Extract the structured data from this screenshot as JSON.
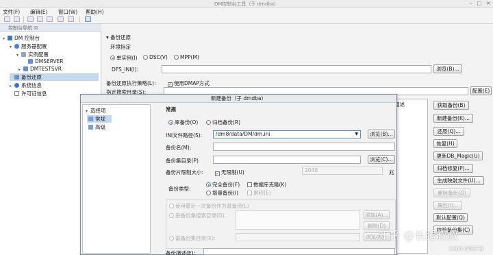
{
  "window": {
    "title": "DM控制台工具（于 dmdba）"
  },
  "menu": [
    "文件(F)",
    "编辑(E)",
    "窗口(W)",
    "帮助(H)"
  ],
  "left_panel": {
    "tab": "控制台导航 ☒",
    "tree": [
      {
        "label": "DM 控制台",
        "level": 0,
        "arrow": "▾"
      },
      {
        "label": "服务器配置",
        "level": 1,
        "arrow": "▾"
      },
      {
        "label": "实例配置",
        "level": 2,
        "arrow": "▾"
      },
      {
        "label": "DMSERVER",
        "level": 3,
        "arrow": ""
      },
      {
        "label": "DMTESTSVR",
        "level": 3,
        "arrow": "▸"
      },
      {
        "label": "备份还原",
        "level": 1,
        "arrow": "",
        "selected": true
      },
      {
        "label": "系统信息",
        "level": 1,
        "arrow": "▸"
      },
      {
        "label": "许可证信息",
        "level": 1,
        "arrow": ""
      }
    ]
  },
  "backup_restore": {
    "section_title": "▾ 备份还原",
    "env_label": "环境指定",
    "modes": [
      "单实例(I)",
      "DSC(V)",
      "MPP(M)"
    ],
    "dfs_ini_label": "DFS_INI(I):",
    "browse_label": "浏览(B)...",
    "strategy_label": "备份还原执行策略(L):",
    "use_dmap_label": "使用DMAP方式",
    "search_dir_label": "指定搜索目录(S):",
    "config_button": "配置(E)",
    "desc_header": "描述",
    "side_buttons": [
      "获取备份(B)",
      "新建备份(K)...",
      "还原(Q)...",
      "恢复(H)",
      "更新DB_Magic(U)",
      "归档修复(P)...",
      "生成映射文件(U)...",
      "删除备份(D)",
      "属性(I)...",
      "默认配置(Q)",
      "校验备份集(C)"
    ],
    "side_disabled": [
      false,
      false,
      false,
      false,
      false,
      false,
      false,
      true,
      true,
      false,
      false
    ]
  },
  "dialog": {
    "title": "新建备份（于 dmdba）",
    "nav_header": "选择项",
    "nav_items": [
      "常规",
      "高级"
    ],
    "section": "常规",
    "backup_kinds": [
      "库备份(O)",
      "归档备份(R)"
    ],
    "ini_label": "INI文件路径(S):",
    "ini_value": "/dm8/data/DM/dm.ini",
    "browse_label": "浏览(B)...",
    "backup_name_label": "备份名(M):",
    "backup_set_dir_label": "备份集目录(P)",
    "browse_c_label": "浏览(C)...",
    "size_limit_label": "备份片限制大小:",
    "unlimited_label": "无限制(U)",
    "size_value": "2048",
    "size_unit": "兆",
    "backup_type_label": "备份类型:",
    "full_backup_label": "完全备份(F)",
    "db_mirror_label": "数据库克隆(K)",
    "incr_backup_label": "增量备份(I)",
    "cumulative_label": "累积(E)",
    "use_last_label": "使用最近一次备份作为基备份(L)",
    "base_dir_label": "基备份集搜索目录(D):",
    "add_label": "添加(A)...",
    "delete_label": "删除(D)",
    "base_set_dir_label": "基备份集目录(X):",
    "browse_n_label": "浏览(N)...",
    "desc_label": "备份描述(E):"
  },
  "watermark": {
    "text": "知乎 @长腿叔叔",
    "csdn": "CSDN @犊子哥"
  }
}
